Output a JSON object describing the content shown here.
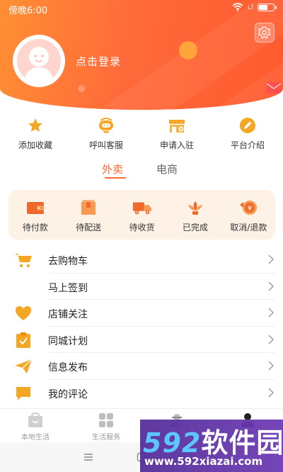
{
  "status_bar": {
    "time": "傍晚6:00",
    "signal": "ʟl"
  },
  "profile": {
    "login_text": "点击登录"
  },
  "quick_actions": [
    {
      "label": "添加收藏",
      "icon": "star-icon"
    },
    {
      "label": "呼叫客服",
      "icon": "headset-icon"
    },
    {
      "label": "申请入驻",
      "icon": "storefront-icon"
    },
    {
      "label": "平台介绍",
      "icon": "pencil-icon"
    }
  ],
  "tabs": {
    "active": "外卖",
    "inactive": "电商"
  },
  "orders": [
    {
      "label": "待付款",
      "icon": "wallet-icon"
    },
    {
      "label": "待配送",
      "icon": "package-icon"
    },
    {
      "label": "待收货",
      "icon": "truck-icon"
    },
    {
      "label": "已完成",
      "icon": "lotus-icon"
    },
    {
      "label": "取消/退款",
      "icon": "refund-coin-icon"
    }
  ],
  "menu": [
    {
      "label": "去购物车",
      "icon": "cart-icon"
    },
    {
      "label": "马上签到",
      "icon": ""
    },
    {
      "label": "店铺关注",
      "icon": "heart-icon"
    },
    {
      "label": "同城计划",
      "icon": "clipboard-check-icon"
    },
    {
      "label": "信息发布",
      "icon": "paper-plane-icon"
    },
    {
      "label": "我的评论",
      "icon": "comment-icon"
    }
  ],
  "bottom_nav": [
    {
      "label": "本地生活",
      "icon": "shopping-bag-icon"
    },
    {
      "label": "生活服务",
      "icon": "grid-icon"
    },
    {
      "label": "",
      "icon": "delivery-person-icon"
    },
    {
      "label": "",
      "icon": "user-icon"
    }
  ],
  "watermark": {
    "brand_num": "592",
    "brand_cn": "软件园",
    "url": "www.592xiazai.com"
  },
  "colors": {
    "accent": "#ff6a33",
    "header_start": "#ff8f33",
    "header_end": "#ff5a2e",
    "icon_orange": "#f39a1e",
    "orders_bg": "#fef2e6"
  }
}
